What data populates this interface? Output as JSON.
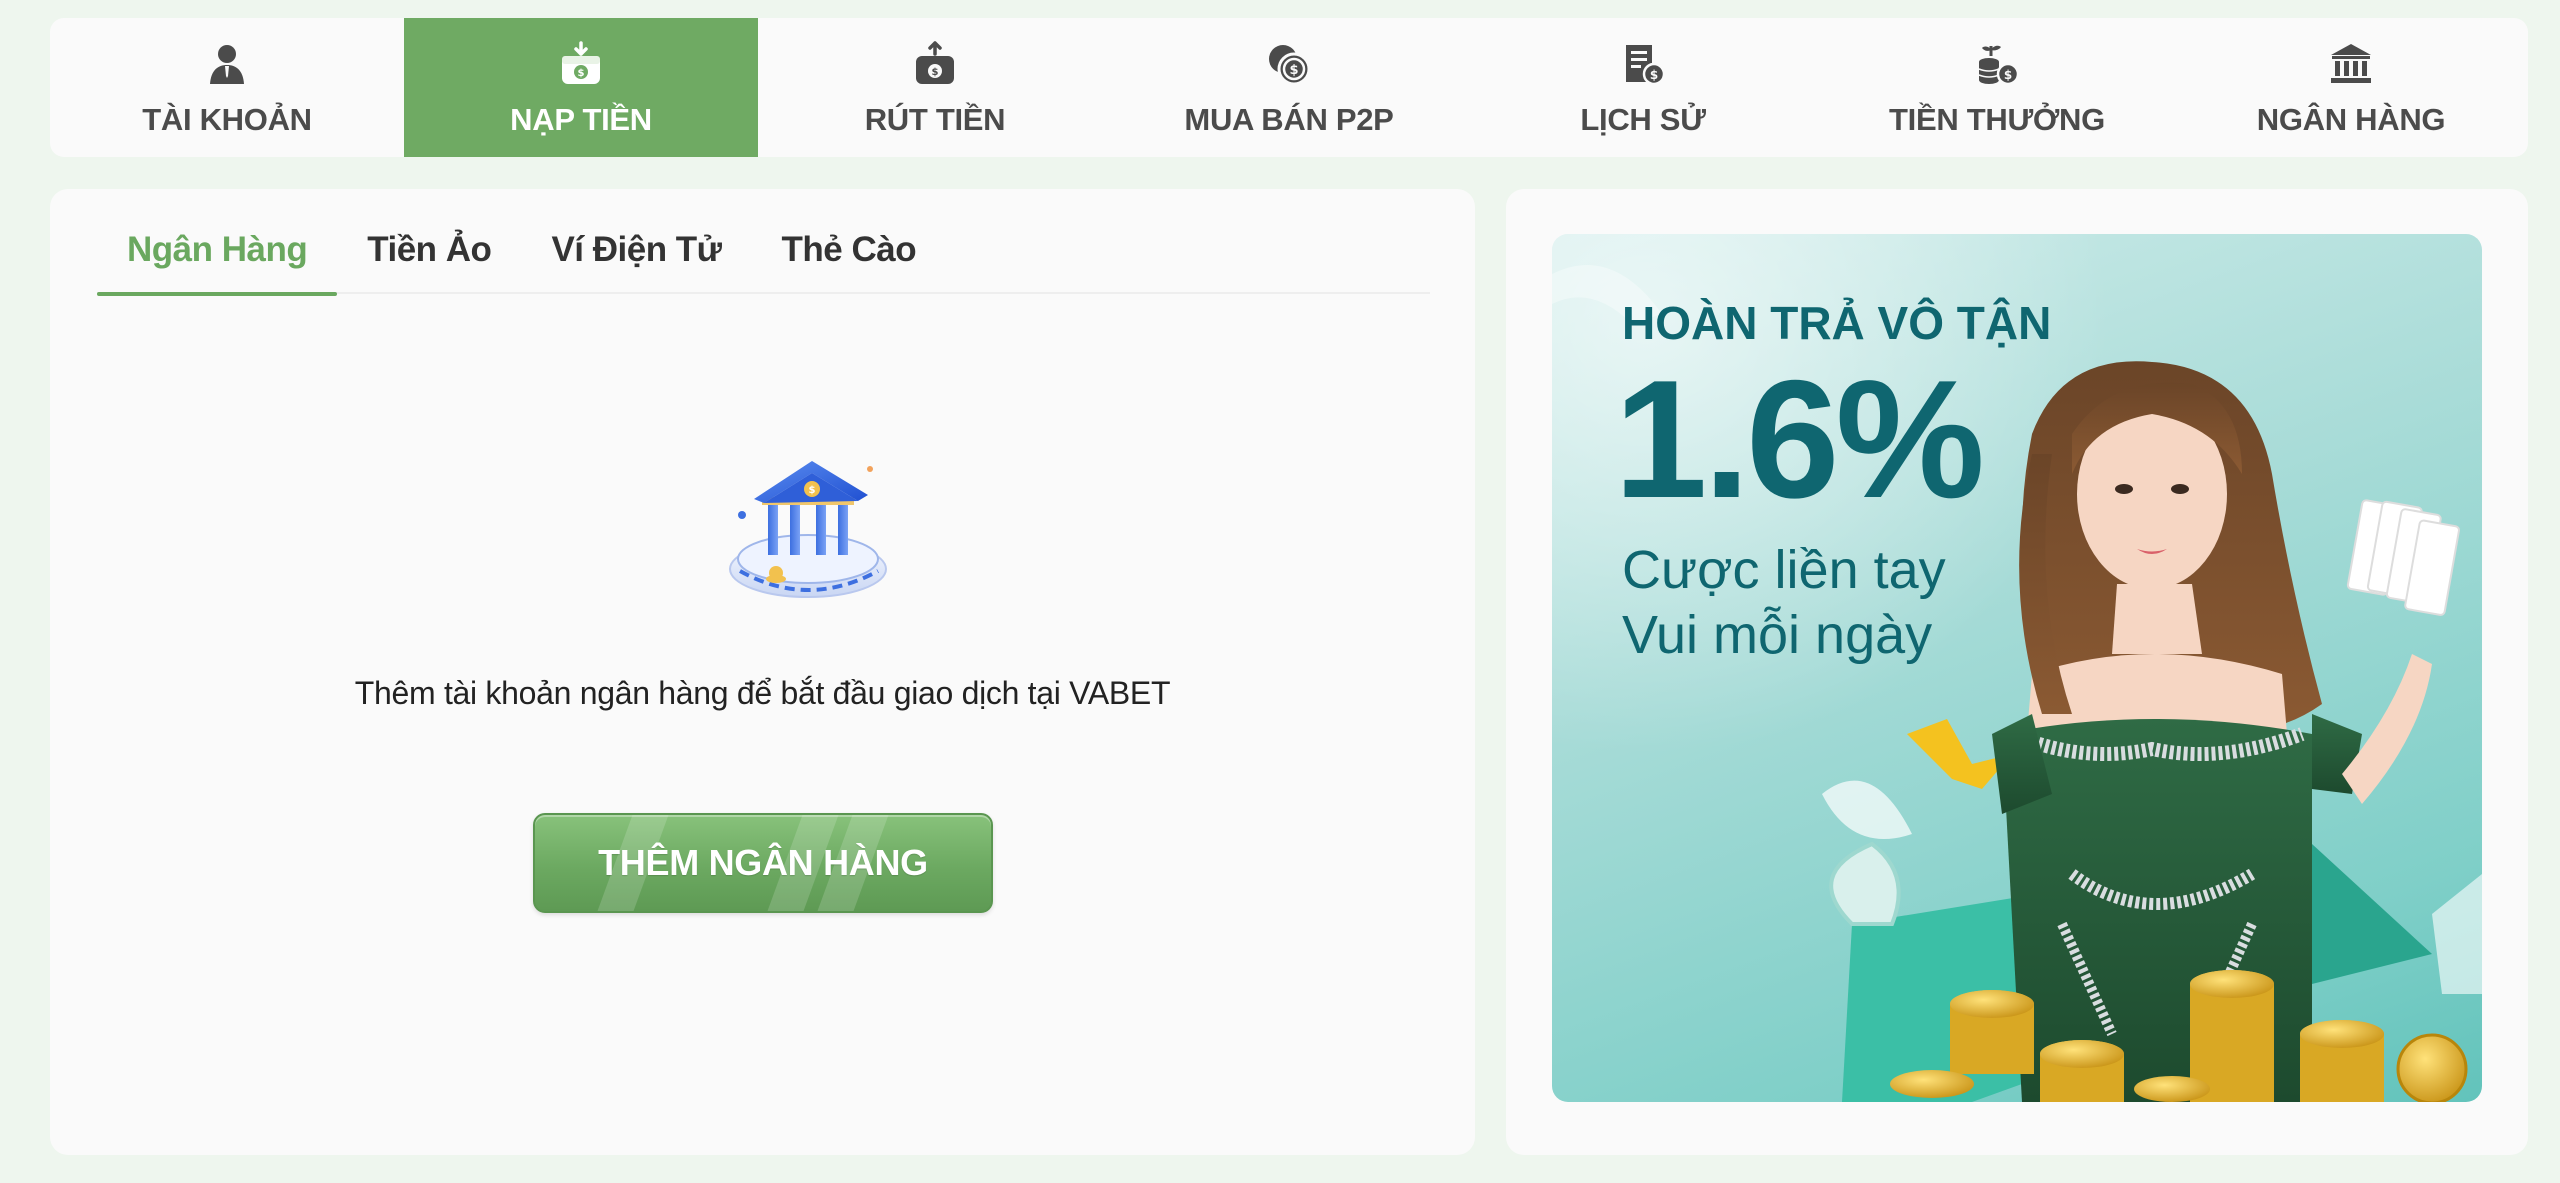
{
  "topnav": {
    "items": [
      {
        "label": "TÀI KHOẢN",
        "icon": "user-icon"
      },
      {
        "label": "NẠP TIỀN",
        "icon": "deposit-icon",
        "active": true
      },
      {
        "label": "RÚT TIỀN",
        "icon": "withdraw-icon"
      },
      {
        "label": "MUA BÁN P2P",
        "icon": "coins-icon"
      },
      {
        "label": "LỊCH SỬ",
        "icon": "history-icon"
      },
      {
        "label": "TIỀN THƯỞNG",
        "icon": "bonus-icon"
      },
      {
        "label": "NGÂN HÀNG",
        "icon": "bank-icon"
      }
    ]
  },
  "subtabs": [
    {
      "label": "Ngân Hàng",
      "active": true
    },
    {
      "label": "Tiền Ảo"
    },
    {
      "label": "Ví Điện Tử"
    },
    {
      "label": "Thẻ Cào"
    }
  ],
  "empty_state": {
    "illustration": "bank-building-icon",
    "message": "Thêm tài khoản ngân hàng để bắt đầu giao dịch tại VABET",
    "button_label": "THÊM NGÂN HÀNG"
  },
  "promo": {
    "heading": "HOÀN TRẢ VÔ TẬN",
    "rate": "1.6%",
    "line1": "Cược liền tay",
    "line2": "Vui mỗi ngày"
  },
  "colors": {
    "accent": "#6faa63",
    "background": "#eef6ee",
    "promo_text": "#0f6670"
  }
}
